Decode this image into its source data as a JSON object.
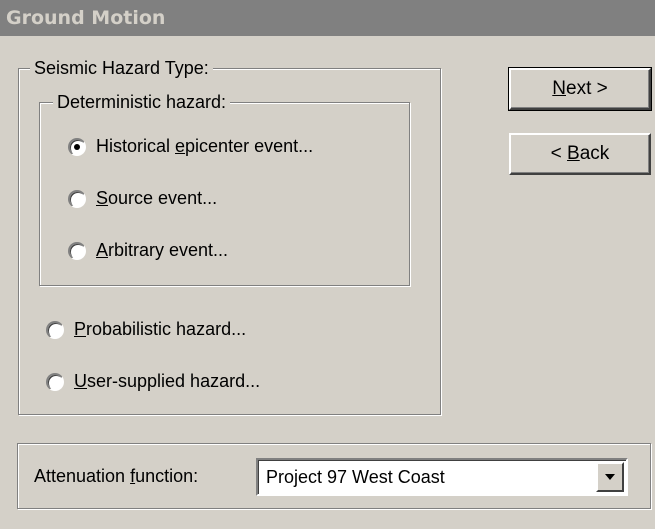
{
  "window": {
    "title": "Ground Motion"
  },
  "hazard_group": {
    "legend": "Seismic Hazard Type:",
    "deterministic_group": {
      "legend": "Deterministic hazard:",
      "options": [
        {
          "prefix": "Historical ",
          "mnemonic": "e",
          "suffix": "picenter event...",
          "checked": true
        },
        {
          "prefix": "",
          "mnemonic": "S",
          "suffix": "ource event...",
          "checked": false
        },
        {
          "prefix": "",
          "mnemonic": "A",
          "suffix": "rbitrary event...",
          "checked": false
        }
      ]
    },
    "options": [
      {
        "prefix": "",
        "mnemonic": "P",
        "suffix": "robabilistic hazard...",
        "checked": false
      },
      {
        "prefix": "",
        "mnemonic": "U",
        "suffix": "ser-supplied hazard...",
        "checked": false
      }
    ]
  },
  "buttons": {
    "next": {
      "prefix": "",
      "mnemonic": "N",
      "suffix": "ext >"
    },
    "back": {
      "prefix": "< ",
      "mnemonic": "B",
      "suffix": "ack"
    }
  },
  "attenuation": {
    "label_prefix": "Attenuation ",
    "label_mnemonic": "f",
    "label_suffix": "unction:",
    "selected_value": "Project 97 West Coast"
  }
}
